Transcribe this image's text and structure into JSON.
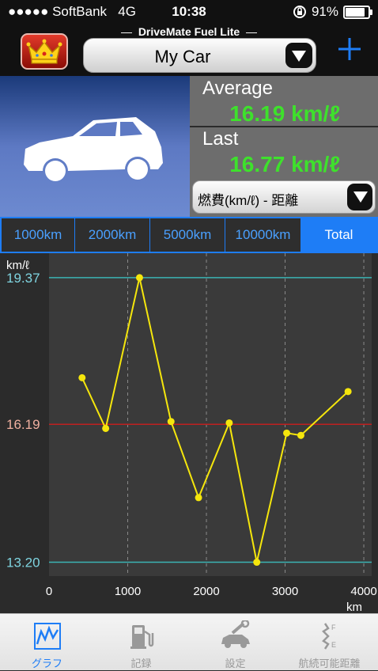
{
  "status_bar": {
    "carrier": "●●●●● SoftBank",
    "network": "4G",
    "time": "10:38",
    "battery": "91%",
    "battery_level": 0.91
  },
  "header": {
    "app_title": "DriveMate Fuel Lite",
    "car_select_value": "My Car",
    "crown_icon": "crown-icon",
    "add_icon": "plus-icon"
  },
  "stats": {
    "average_label": "Average",
    "average_value": "16.19 km/ℓ",
    "last_label": "Last",
    "last_value": "16.77 km/ℓ",
    "metric_select_value": "燃費(km/ℓ) - 距離"
  },
  "range_tabs": {
    "items": [
      "1000km",
      "2000km",
      "5000km",
      "10000km",
      "Total"
    ],
    "active": "Total"
  },
  "chart_data": {
    "type": "line",
    "ylabel": "km/ℓ",
    "xlabel": "km",
    "xlim": [
      0,
      4100
    ],
    "ylim": [
      12.9,
      19.9
    ],
    "x_ticks": [
      0,
      1000,
      2000,
      3000,
      4000
    ],
    "y_reference_lines": [
      {
        "value": 19.37,
        "label": "19.37",
        "color": "#3bb4b4"
      },
      {
        "value": 16.19,
        "label": "16.19",
        "color": "#c02020"
      },
      {
        "value": 13.2,
        "label": "13.20",
        "color": "#3bb4b4"
      }
    ],
    "series": [
      {
        "color": "#f5e60c",
        "points": [
          [
            420,
            17.2
          ],
          [
            720,
            16.1
          ],
          [
            1150,
            19.37
          ],
          [
            1550,
            16.25
          ],
          [
            1900,
            14.6
          ],
          [
            2290,
            16.22
          ],
          [
            2640,
            13.2
          ],
          [
            3020,
            16.0
          ],
          [
            3200,
            15.95
          ],
          [
            3800,
            16.9
          ]
        ]
      }
    ],
    "grid": true
  },
  "tabbar": {
    "items": [
      {
        "label": "グラフ",
        "icon": "graph-icon",
        "active": true
      },
      {
        "label": "記録",
        "icon": "fuel-pump-icon",
        "active": false
      },
      {
        "label": "設定",
        "icon": "car-wrench-icon",
        "active": false
      },
      {
        "label": "航続可能距離",
        "icon": "range-gauge-icon",
        "active": false
      }
    ]
  }
}
